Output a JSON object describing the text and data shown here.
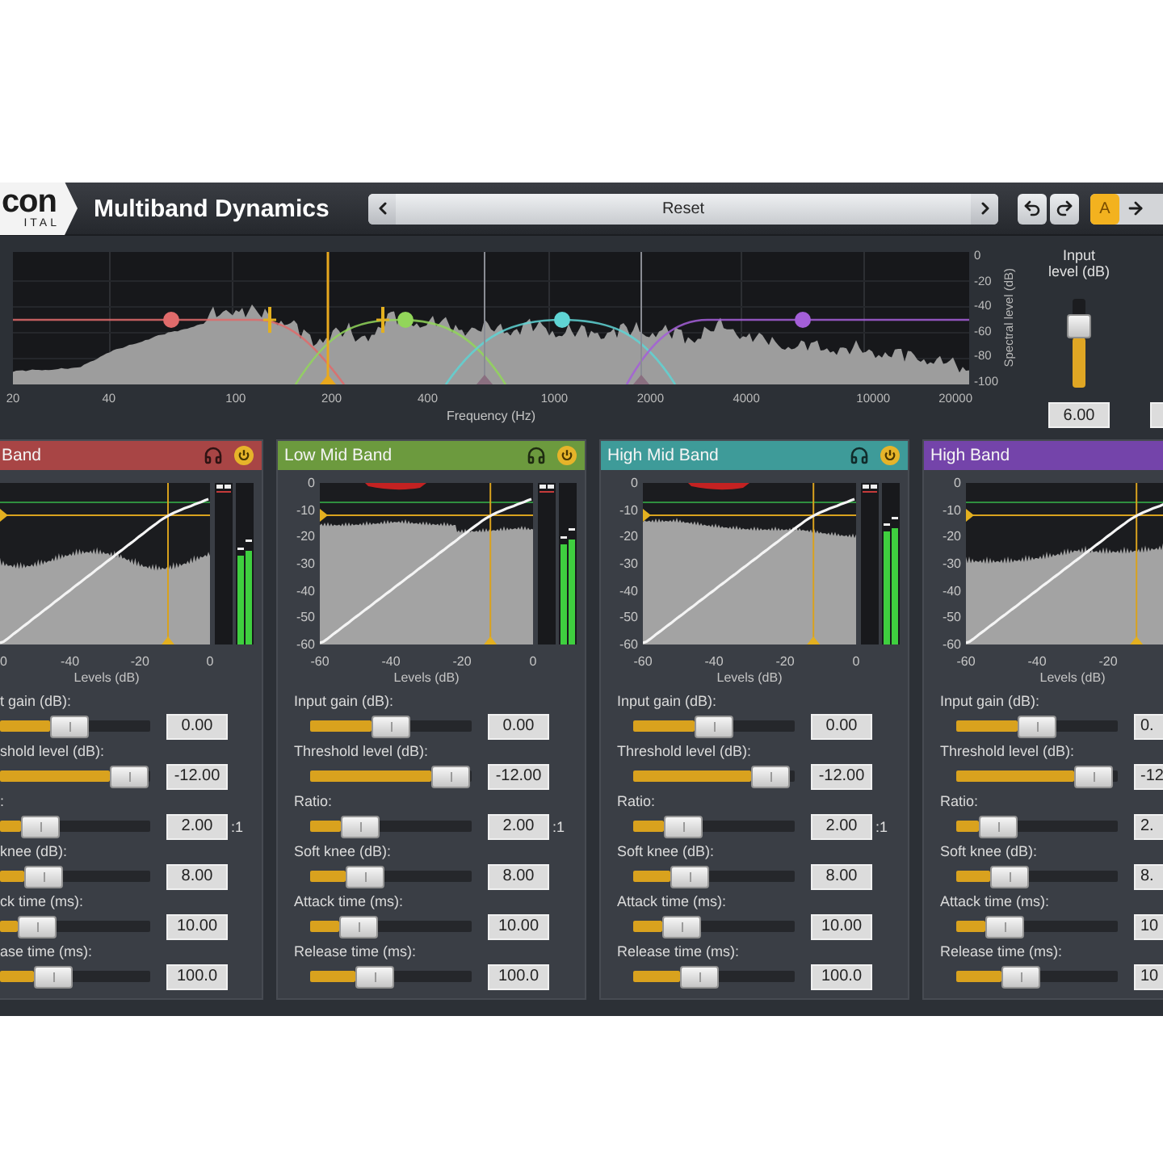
{
  "header": {
    "logo": [
      "con",
      "ITAL"
    ],
    "title": "Multiband Dynamics",
    "preset": "Reset",
    "ab": [
      {
        "label": "A",
        "selected": true
      }
    ]
  },
  "spectrum": {
    "y_ticks": [
      "0",
      "-20",
      "-40",
      "-60",
      "-80",
      "-100"
    ],
    "ylabel": "Spectral level (dB)",
    "x_ticks": [
      "20",
      "40",
      "100",
      "200",
      "400",
      "1000",
      "2000",
      "4000",
      "10000",
      "20000"
    ],
    "xlabel": "Frequency (Hz)",
    "handles": [
      {
        "color": "#e06b6b"
      },
      {
        "color": "#92d65a"
      },
      {
        "color": "#5fd4d4"
      },
      {
        "color": "#a45fd8"
      }
    ],
    "crossovers": [
      {
        "selected": true
      },
      {
        "selected": false
      },
      {
        "selected": false
      }
    ]
  },
  "input_level": {
    "label": "Input level (dB)",
    "level": 0.7,
    "value": "6.00"
  },
  "bands": [
    {
      "title": "Band",
      "color": "#a84545",
      "x_ticks": [
        "0",
        "-40",
        "-20",
        "0"
      ],
      "axis_label": "Levels (dB)",
      "controls": [
        {
          "label": "t gain (dB):",
          "level": 0.46,
          "value": "0.00"
        },
        {
          "label": "shold level (dB):",
          "level": 0.86,
          "value": "-12.00"
        },
        {
          "label": ":",
          "level": 0.27,
          "value": "2.00",
          "unit": ":1"
        },
        {
          "label": "knee (dB):",
          "level": 0.29,
          "value": "8.00"
        },
        {
          "label": "ck time (ms):",
          "level": 0.25,
          "value": "10.00"
        },
        {
          "label": "ase time (ms):",
          "level": 0.36,
          "value": "100.0"
        }
      ]
    },
    {
      "title": "Low Mid Band",
      "color": "#6c9a3e",
      "y_ticks": [
        "0",
        "-10",
        "-20",
        "-30",
        "-40",
        "-50",
        "-60"
      ],
      "x_ticks": [
        "-60",
        "-40",
        "-20",
        "0"
      ],
      "axis_label": "Levels (dB)",
      "controls": [
        {
          "label": "Input gain (dB):",
          "level": 0.5,
          "value": "0.00"
        },
        {
          "label": "Threshold level (dB):",
          "level": 0.87,
          "value": "-12.00"
        },
        {
          "label": "Ratio:",
          "level": 0.31,
          "value": "2.00",
          "unit": ":1"
        },
        {
          "label": "Soft knee (dB):",
          "level": 0.34,
          "value": "8.00"
        },
        {
          "label": "Attack time (ms):",
          "level": 0.3,
          "value": "10.00"
        },
        {
          "label": "Release time (ms):",
          "level": 0.4,
          "value": "100.0"
        }
      ]
    },
    {
      "title": "High Mid Band",
      "color": "#3e9b99",
      "y_ticks": [
        "0",
        "-10",
        "-20",
        "-30",
        "-40",
        "-50",
        "-60"
      ],
      "x_ticks": [
        "-60",
        "-40",
        "-20",
        "0"
      ],
      "axis_label": "Levels (dB)",
      "controls": [
        {
          "label": "Input gain (dB):",
          "level": 0.5,
          "value": "0.00"
        },
        {
          "label": "Threshold level (dB):",
          "level": 0.85,
          "value": "-12.00"
        },
        {
          "label": "Ratio:",
          "level": 0.31,
          "value": "2.00",
          "unit": ":1"
        },
        {
          "label": "Soft knee (dB):",
          "level": 0.35,
          "value": "8.00"
        },
        {
          "label": "Attack time (ms):",
          "level": 0.3,
          "value": "10.00"
        },
        {
          "label": "Release time (ms):",
          "level": 0.41,
          "value": "100.0"
        }
      ]
    },
    {
      "title": "High Band",
      "color": "#7444aa",
      "y_ticks": [
        "0",
        "-10",
        "-20",
        "-30",
        "-40",
        "-50",
        "-60"
      ],
      "x_ticks": [
        "-60",
        "-40",
        "-20"
      ],
      "axis_label": "Levels (dB)",
      "controls": [
        {
          "label": "Input gain (dB):",
          "level": 0.5,
          "value": "0."
        },
        {
          "label": "Threshold level (dB):",
          "level": 0.85,
          "value": "-12"
        },
        {
          "label": "Ratio:",
          "level": 0.26,
          "value": "2."
        },
        {
          "label": "Soft knee (dB):",
          "level": 0.33,
          "value": "8."
        },
        {
          "label": "Attack time (ms):",
          "level": 0.3,
          "value": "10"
        },
        {
          "label": "Release time (ms):",
          "level": 0.4,
          "value": "10"
        }
      ]
    }
  ]
}
